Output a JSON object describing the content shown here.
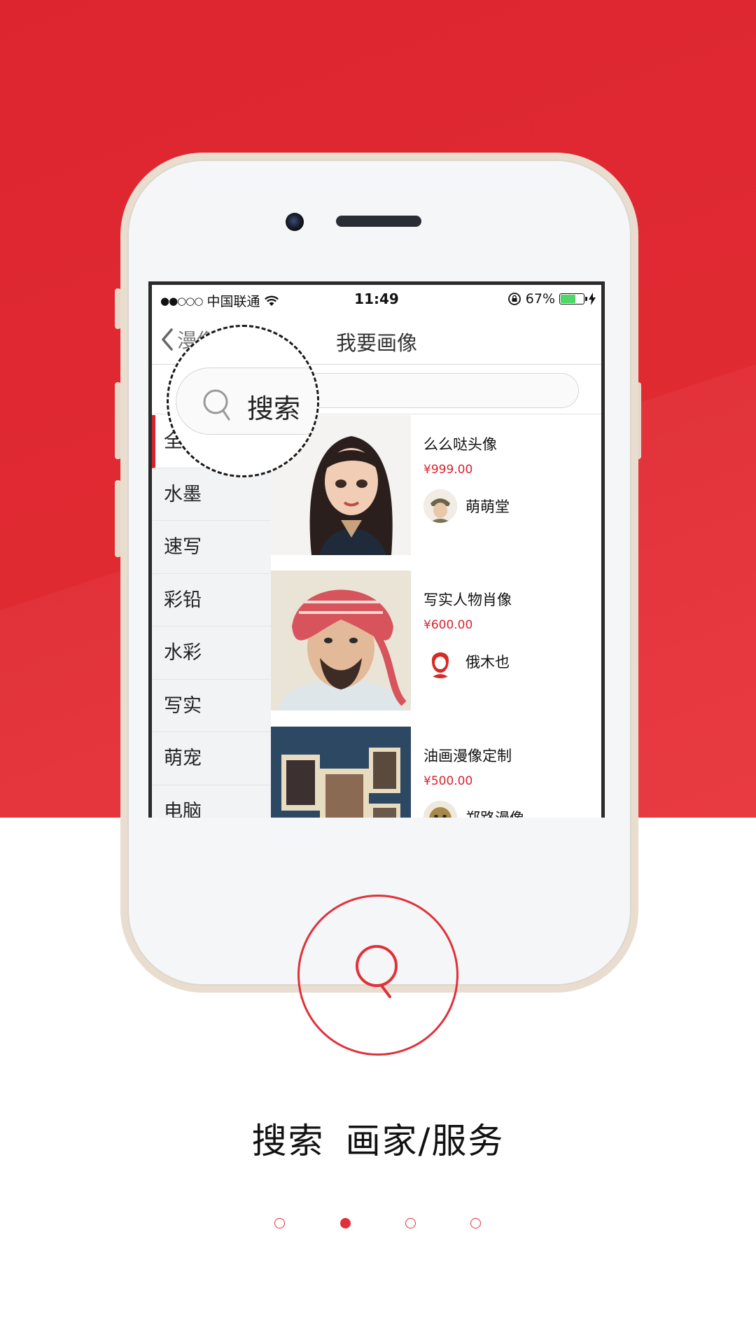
{
  "status_bar": {
    "signal": "●●○○○",
    "carrier": "中国联通",
    "time": "11:49",
    "battery": "67%",
    "battery_level": 0.67
  },
  "nav": {
    "back_label": "漫像",
    "title": "我要画像"
  },
  "search": {
    "label": "搜索"
  },
  "categories": [
    {
      "label": "全部",
      "active": true
    },
    {
      "label": "水墨"
    },
    {
      "label": "速写"
    },
    {
      "label": "彩铅"
    },
    {
      "label": "水彩"
    },
    {
      "label": "写实"
    },
    {
      "label": "萌宠"
    },
    {
      "label": "电脑"
    }
  ],
  "items": [
    {
      "title": "么么哒头像",
      "price": "¥999.00",
      "seller": "萌萌堂"
    },
    {
      "title": "写实人物肖像",
      "price": "¥600.00",
      "seller": "俄木也"
    },
    {
      "title": "油画漫像定制",
      "price": "¥500.00",
      "seller": "郑路漫像"
    }
  ],
  "feature": {
    "icon": "search-icon",
    "caption_part1": "搜索",
    "caption_part2": "画家/服务"
  },
  "pager": {
    "count": 4,
    "active_index": 1
  },
  "colors": {
    "brand_red": "#e0313a",
    "price_red": "#d9232e",
    "battery_green": "#4cd964"
  }
}
